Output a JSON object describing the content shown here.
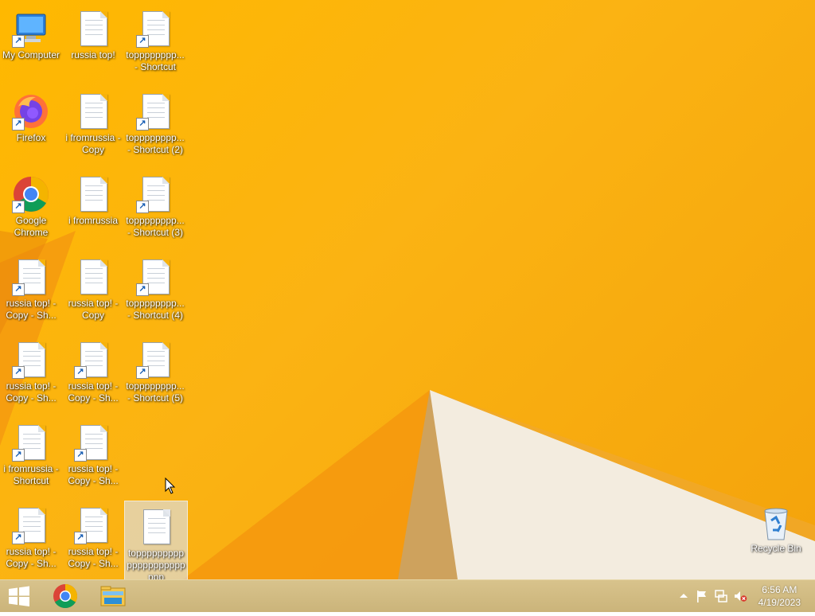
{
  "desktop": {
    "icons": [
      {
        "label": "My Computer",
        "type": "computer",
        "shortcut": true
      },
      {
        "label": "russia top!",
        "type": "doc",
        "shortcut": false
      },
      {
        "label": "topppppppp... - Shortcut",
        "type": "doc",
        "shortcut": true
      },
      {
        "label": "Firefox",
        "type": "firefox",
        "shortcut": true
      },
      {
        "label": "i fromrussia - Copy",
        "type": "doc",
        "shortcut": false
      },
      {
        "label": "topppppppp... - Shortcut (2)",
        "type": "doc",
        "shortcut": true
      },
      {
        "label": "Google Chrome",
        "type": "chrome",
        "shortcut": true
      },
      {
        "label": "i fromrussia",
        "type": "doc",
        "shortcut": false
      },
      {
        "label": "topppppppp... - Shortcut (3)",
        "type": "doc",
        "shortcut": true
      },
      {
        "label": "russia top! - Copy - Sh...",
        "type": "doc",
        "shortcut": true
      },
      {
        "label": "russia top! - Copy",
        "type": "doc",
        "shortcut": false
      },
      {
        "label": "topppppppp... - Shortcut (4)",
        "type": "doc",
        "shortcut": true
      },
      {
        "label": "russia top! - Copy - Sh...",
        "type": "doc",
        "shortcut": true
      },
      {
        "label": "russia top! - Copy - Sh...",
        "type": "doc",
        "shortcut": true
      },
      {
        "label": "topppppppp... - Shortcut (5)",
        "type": "doc",
        "shortcut": true
      },
      {
        "label": "i fromrussia - Shortcut",
        "type": "doc",
        "shortcut": true
      },
      {
        "label": "russia top! - Copy - Sh...",
        "type": "doc",
        "shortcut": true
      },
      {
        "label": "russia top! - Copy - Sh...",
        "type": "doc",
        "shortcut": true
      },
      {
        "label": "russia top! - Copy - Sh...",
        "type": "doc",
        "shortcut": true
      },
      {
        "label": "toppppppppppppppppppppppp",
        "type": "doc",
        "shortcut": false,
        "selected": true
      }
    ],
    "recycle_bin": {
      "label": "Recycle Bin"
    }
  },
  "taskbar": {
    "pinned": [
      "windows-logo-icon",
      "chrome-icon",
      "file-explorer-icon"
    ],
    "tray_icons": [
      "show-hidden-icons-arrow",
      "action-center-flag-icon",
      "network-icon",
      "volume-muted-icon"
    ],
    "clock": {
      "time": "6:56 AM",
      "date": "4/19/2023"
    }
  },
  "colors": {
    "wallpaper": "#fbb313",
    "taskbar": "#d1bc83",
    "selection": "#dce1e8"
  }
}
